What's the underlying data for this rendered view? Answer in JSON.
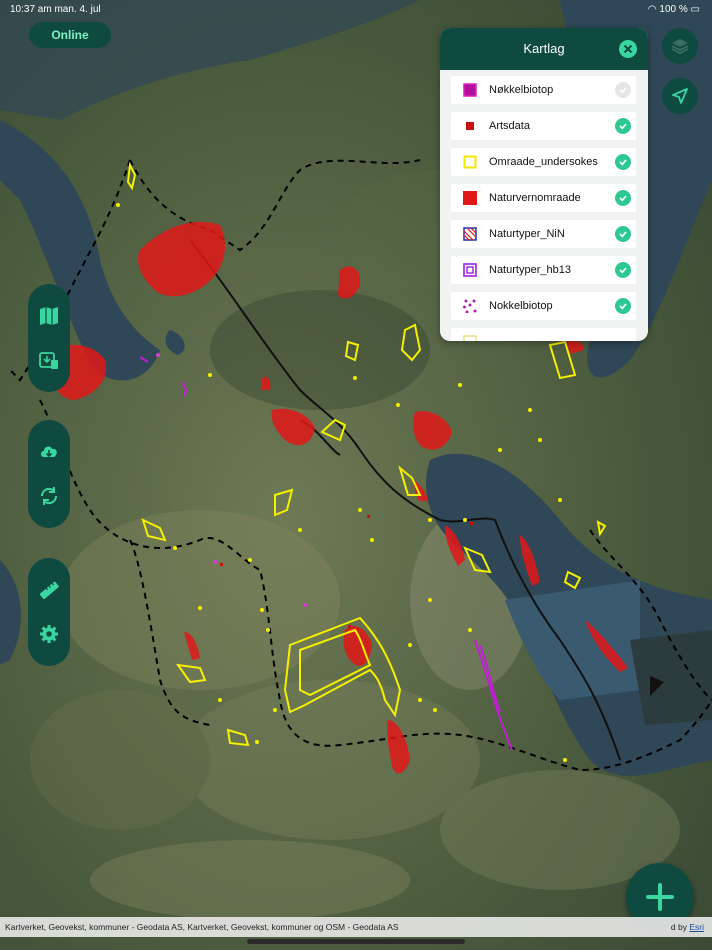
{
  "status_bar": {
    "time": "10:37 am  man. 4. jul",
    "battery": "100 %"
  },
  "connection": {
    "label": "Online"
  },
  "layers_panel": {
    "title": "Kartlag",
    "items": [
      {
        "label": "Nøkkelbiotop",
        "checked": false
      },
      {
        "label": "Artsdata",
        "checked": true
      },
      {
        "label": "Omraade_undersokes",
        "checked": true
      },
      {
        "label": "Naturvernomraade",
        "checked": true
      },
      {
        "label": "Naturtyper_NiN",
        "checked": true
      },
      {
        "label": "Naturtyper_hb13",
        "checked": true
      },
      {
        "label": "Nokkelbiotop",
        "checked": true
      }
    ]
  },
  "attribution": {
    "text": "Kartverket, Geovekst, kommuner - Geodata AS, Kartverket, Geovekst, kommuner og OSM - Geodata AS",
    "powered_prefix": "d by ",
    "powered_link": "Esri"
  },
  "icons": {
    "layers": "layers-stack-icon",
    "locate": "navigation-arrow-icon",
    "map": "folded-map-icon",
    "offline": "map-download-icon",
    "download": "cloud-download-icon",
    "sync": "sync-icon",
    "measure": "ruler-icon",
    "settings": "gear-icon",
    "add": "plus-icon"
  },
  "colors": {
    "accent_dark": "#0f4a40",
    "accent_light": "#3ad6a0",
    "protected_area": "#e01818",
    "survey_area": "#f5f000",
    "habitat_hb13": "#a020e0"
  }
}
